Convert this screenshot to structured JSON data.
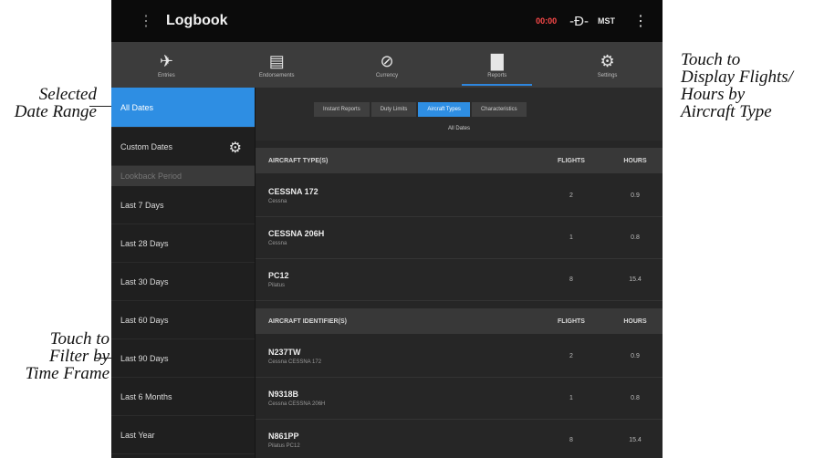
{
  "annotations": {
    "selected_date_range": [
      "Selected",
      "Date Range"
    ],
    "aircraft_type": [
      "Touch to",
      "Display Flights/",
      "Hours by",
      "Aircraft Type"
    ],
    "time_frame": [
      "Touch to",
      "Filter by",
      "Time Frame"
    ]
  },
  "app": {
    "title": "Logbook",
    "status_red": "00:00",
    "status_time": "MST",
    "menu_icon": "menu-icon",
    "connect_icon": "connector-icon",
    "overflow_icon": "overflow-menu-icon"
  },
  "nav": {
    "tabs": [
      {
        "label": "Entries",
        "icon": "airplane-icon",
        "glyph": "✈",
        "active": false
      },
      {
        "label": "Endorsements",
        "icon": "document-icon",
        "glyph": "▤",
        "active": false
      },
      {
        "label": "Currency",
        "icon": "compass-icon",
        "glyph": "⊘",
        "active": false
      },
      {
        "label": "Reports",
        "icon": "bar-chart-icon",
        "glyph": "▇",
        "active": true
      },
      {
        "label": "Settings",
        "icon": "gear-icon",
        "glyph": "⚙",
        "active": false
      }
    ]
  },
  "sidebar": {
    "all_dates": "All Dates",
    "custom_dates": "Custom Dates",
    "lookback_header": "Lookback Period",
    "periods": [
      "Last 7 Days",
      "Last 28 Days",
      "Last 30 Days",
      "Last 60 Days",
      "Last 90 Days",
      "Last 6 Months",
      "Last Year"
    ]
  },
  "reports": {
    "segments": [
      "Instant Reports",
      "Duty Limits",
      "Aircraft Types",
      "Characteristics"
    ],
    "active_segment": "Aircraft Types",
    "range_label": "All Dates",
    "type_header": {
      "name": "AIRCRAFT TYPE(S)",
      "flights": "FLIGHTS",
      "hours": "HOURS"
    },
    "types": [
      {
        "name": "CESSNA 172",
        "maker": "Cessna",
        "flights": "2",
        "hours": "0.9"
      },
      {
        "name": "CESSNA 206H",
        "maker": "Cessna",
        "flights": "1",
        "hours": "0.8"
      },
      {
        "name": "PC12",
        "maker": "Pilatus",
        "flights": "8",
        "hours": "15.4"
      }
    ],
    "ident_header": {
      "name": "AIRCRAFT IDENTIFIER(S)",
      "flights": "FLIGHTS",
      "hours": "HOURS"
    },
    "identifiers": [
      {
        "name": "N237TW",
        "model": "Cessna CESSNA 172",
        "flights": "2",
        "hours": "0.9"
      },
      {
        "name": "N9318B",
        "model": "Cessna CESSNA 206H",
        "flights": "1",
        "hours": "0.8"
      },
      {
        "name": "N861PP",
        "model": "Pilatus PC12",
        "flights": "8",
        "hours": "15.4"
      }
    ]
  },
  "colors": {
    "accent": "#2e8ee3",
    "alert": "#ff4a4a",
    "background": "#232323"
  }
}
